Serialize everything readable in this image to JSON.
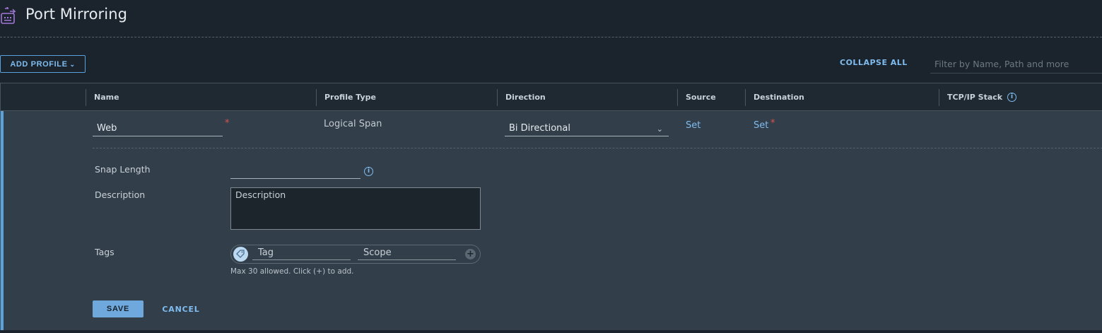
{
  "header": {
    "title": "Port Mirroring",
    "icon": "port-mirroring-icon"
  },
  "toolbar": {
    "add_profile_label": "ADD PROFILE",
    "collapse_all_label": "COLLAPSE ALL",
    "filter_placeholder": "Filter by Name, Path and more"
  },
  "table": {
    "columns": {
      "name": "Name",
      "profile_type": "Profile Type",
      "direction": "Direction",
      "source": "Source",
      "destination": "Destination",
      "tcpip_stack": "TCP/IP Stack"
    }
  },
  "row": {
    "name_value": "Web",
    "required_marker": "*",
    "profile_type": "Logical Span",
    "direction": "Bi Directional",
    "source_link": "Set",
    "destination_link": "Set"
  },
  "form": {
    "snap_length_label": "Snap Length",
    "snap_length_value": "",
    "description_label": "Description",
    "description_placeholder": "Description",
    "tags_label": "Tags",
    "tag_placeholder": "Tag",
    "scope_placeholder": "Scope",
    "tags_hint": "Max 30 allowed. Click (+) to add.",
    "save_label": "SAVE",
    "cancel_label": "CANCEL"
  },
  "colors": {
    "accent": "#5aa2de",
    "link": "#7fbdf0",
    "required": "#d9534f",
    "background": "#1b232c",
    "row_background": "#323e49"
  }
}
